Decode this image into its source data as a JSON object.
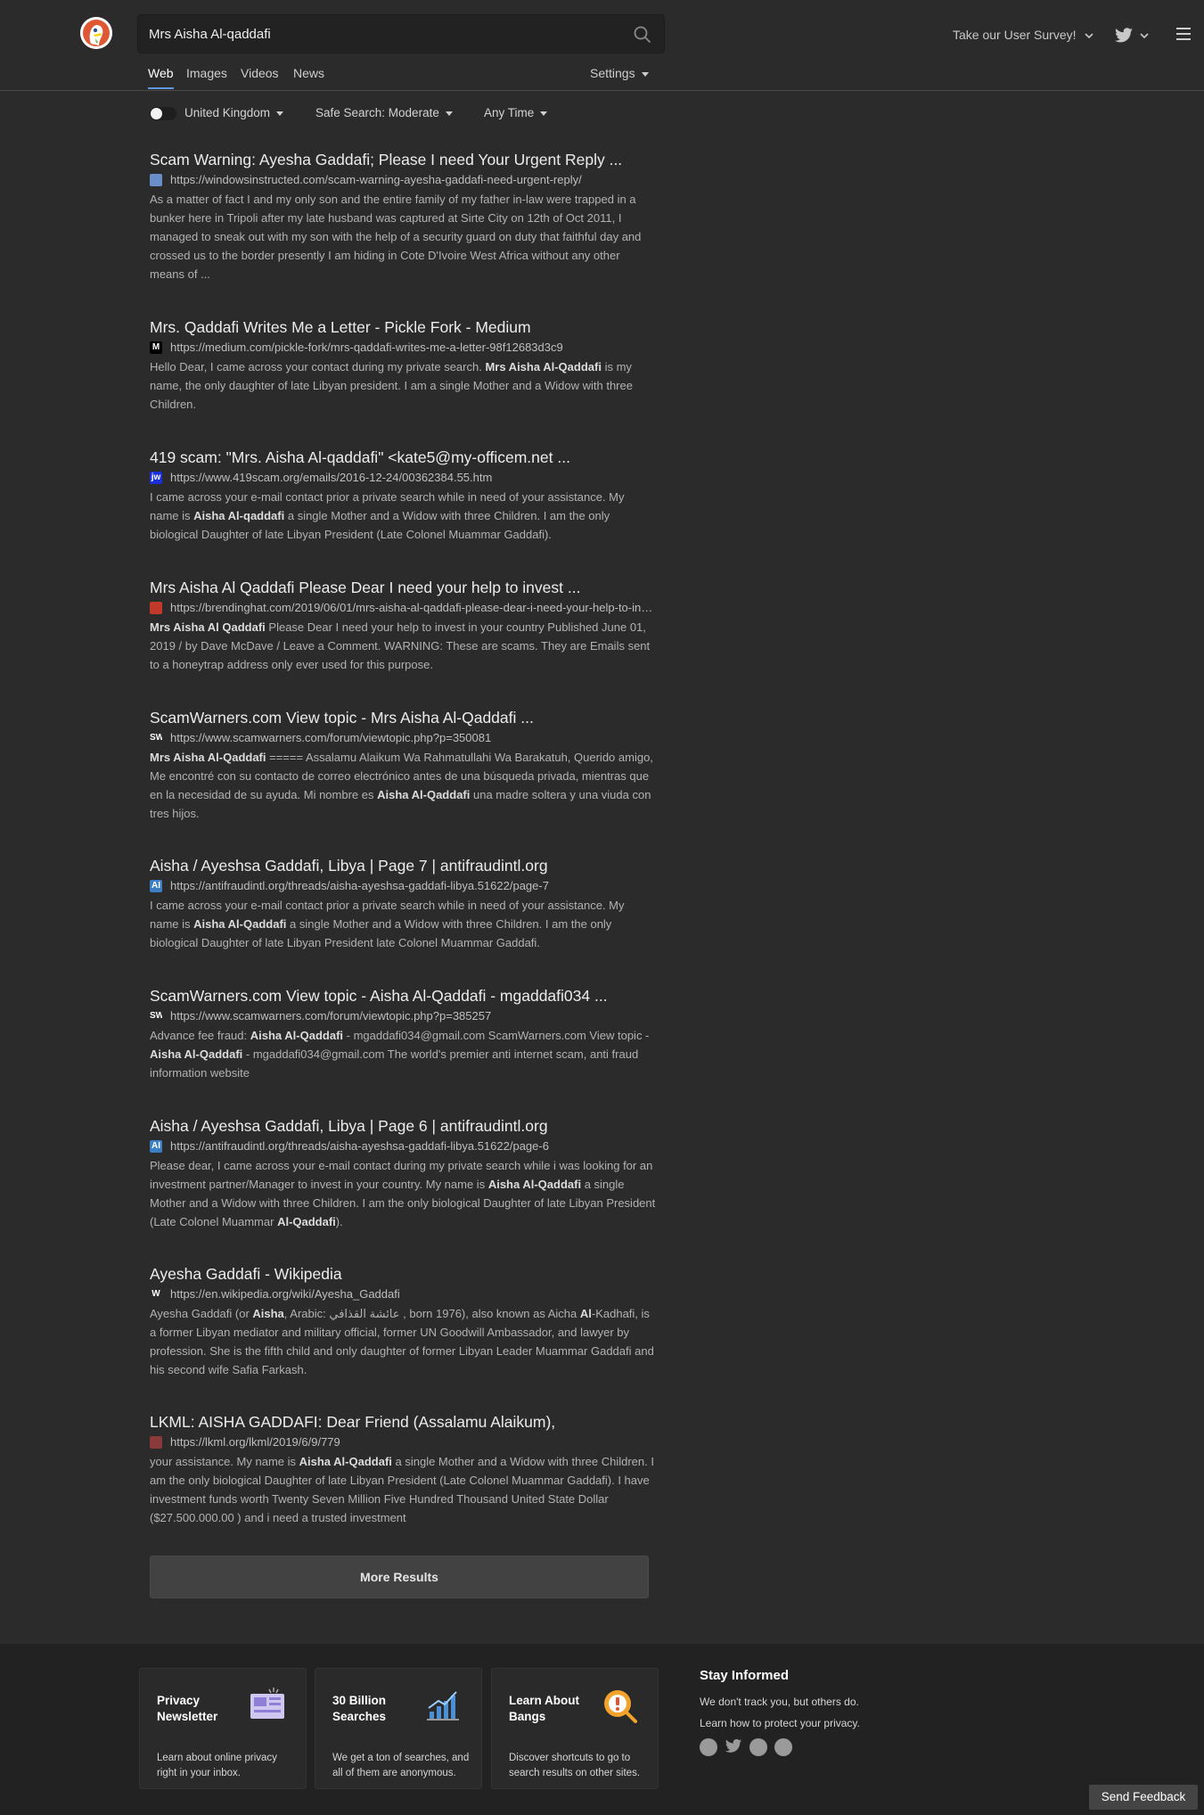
{
  "search": {
    "query": "Mrs Aisha Al-qaddafi"
  },
  "header": {
    "survey_label": "Take our User Survey!",
    "tabs": [
      {
        "label": "Web",
        "active": true
      },
      {
        "label": "Images",
        "active": false
      },
      {
        "label": "Videos",
        "active": false
      },
      {
        "label": "News",
        "active": false
      }
    ],
    "settings_label": "Settings"
  },
  "filters": {
    "region": "United Kingdom",
    "safe_search": "Safe Search: Moderate",
    "time": "Any Time"
  },
  "results": [
    {
      "title": "Scam Warning: Ayesha Gaddafi; Please I need Your Urgent Reply ...",
      "url": "https://windowsinstructed.com/scam-warning-ayesha-gaddafi-need-urgent-reply/",
      "favicon_color": "#6a8fc8",
      "snippet": [
        {
          "t": "As a matter of fact I and my only son and the entire family of my father in-law were trapped in a bunker here in Tripoli after my late husband was captured at Sirte City on 12th of Oct 2011, I managed to sneak out with my son with the help of a security guard on duty that faithful day and crossed us to the border presently I am hiding in Cote D'Ivoire West Africa without any other means of ...",
          "b": false
        }
      ]
    },
    {
      "title": "Mrs. Qaddafi Writes Me a Letter - Pickle Fork - Medium",
      "url": "https://medium.com/pickle-fork/mrs-qaddafi-writes-me-a-letter-98f12683d3c9",
      "favicon_color": "#000000",
      "favicon_text": "M",
      "snippet": [
        {
          "t": "Hello Dear, I came across your contact during my private search. ",
          "b": false
        },
        {
          "t": "Mrs Aisha Al-Qaddafi",
          "b": true
        },
        {
          "t": " is my name, the only daughter of late Libyan president. I am a single Mother and a Widow with three Children.",
          "b": false
        }
      ]
    },
    {
      "title": "419 scam: \"Mrs. Aisha Al-qaddafi\" <kate5@my-officem.net ...",
      "url": "https://www.419scam.org/emails/2016-12-24/00362384.55.htm",
      "favicon_color": "#1a2fd6",
      "favicon_text": "jw",
      "snippet": [
        {
          "t": "I came across your e-mail contact prior a private search while in need of your assistance. My name is ",
          "b": false
        },
        {
          "t": "Aisha Al-qaddafi",
          "b": true
        },
        {
          "t": " a single Mother and a Widow with three Children. I am the only biological Daughter of late Libyan President (Late Colonel Muammar Gaddafi).",
          "b": false
        }
      ]
    },
    {
      "title": "Mrs Aisha Al Qaddafi Please Dear I need your help to invest ...",
      "url": "https://brendinghat.com/2019/06/01/mrs-aisha-al-qaddafi-please-dear-i-need-your-help-to-invest/",
      "favicon_color": "#c0392b",
      "snippet": [
        {
          "t": "Mrs Aisha Al Qaddafi",
          "b": true
        },
        {
          "t": " Please Dear I need your help to invest in your country Published June 01, 2019 / by Dave McDave / Leave a Comment. WARNING: These are scams. They are Emails sent to a honeytrap address only ever used for this purpose.",
          "b": false
        }
      ]
    },
    {
      "title": "ScamWarners.com View topic - Mrs Aisha Al-Qaddafi ...",
      "url": "https://www.scamwarners.com/forum/viewtopic.php?p=350081",
      "favicon_color": "#2b2b2b",
      "favicon_text": "SW",
      "snippet": [
        {
          "t": "Mrs Aisha Al-Qaddafi",
          "b": true
        },
        {
          "t": " ===== Assalamu Alaikum Wa Rahmatullahi Wa Barakatuh, Querido amigo, Me encontré con su contacto de correo electrónico antes de una búsqueda privada, mientras que en la necesidad de su ayuda. Mi nombre es ",
          "b": false
        },
        {
          "t": "Aisha Al-Qaddafi",
          "b": true
        },
        {
          "t": " una madre soltera y una viuda con tres hijos.",
          "b": false
        }
      ]
    },
    {
      "title": "Aisha / Ayeshsa Gaddafi, Libya | Page 7 | antifraudintl.org",
      "url": "https://antifraudintl.org/threads/aisha-ayeshsa-gaddafi-libya.51622/page-7",
      "favicon_color": "#3d7fc4",
      "favicon_text": "AI",
      "snippet": [
        {
          "t": "I came across your e-mail contact prior a private search while in need of your assistance. My name is ",
          "b": false
        },
        {
          "t": "Aisha Al-Qaddafi",
          "b": true
        },
        {
          "t": " a single Mother and a Widow with three Children. I am the only biological Daughter of late Libyan President late Colonel Muammar Gaddafi.",
          "b": false
        }
      ]
    },
    {
      "title": "ScamWarners.com View topic - Aisha Al-Qaddafi - mgaddafi034 ...",
      "url": "https://www.scamwarners.com/forum/viewtopic.php?p=385257",
      "favicon_color": "#2b2b2b",
      "favicon_text": "SW",
      "snippet": [
        {
          "t": "Advance fee fraud: ",
          "b": false
        },
        {
          "t": "Aisha Al-Qaddafi",
          "b": true
        },
        {
          "t": " - mgaddafi034@gmail.com ScamWarners.com View topic - ",
          "b": false
        },
        {
          "t": "Aisha Al-Qaddafi",
          "b": true
        },
        {
          "t": " - mgaddafi034@gmail.com The world's premier anti internet scam, anti fraud information website",
          "b": false
        }
      ]
    },
    {
      "title": "Aisha / Ayeshsa Gaddafi, Libya | Page 6 | antifraudintl.org",
      "url": "https://antifraudintl.org/threads/aisha-ayeshsa-gaddafi-libya.51622/page-6",
      "favicon_color": "#3d7fc4",
      "favicon_text": "AI",
      "snippet": [
        {
          "t": "Please dear, I came across your e-mail contact during my private search while i was looking for an investment partner/Manager to invest in your country. My name is ",
          "b": false
        },
        {
          "t": "Aisha Al-Qaddafi",
          "b": true
        },
        {
          "t": " a single Mother and a Widow with three Children. I am the only biological Daughter of late Libyan President (Late Colonel Muammar ",
          "b": false
        },
        {
          "t": "Al-Qaddafi",
          "b": true
        },
        {
          "t": ").",
          "b": false
        }
      ]
    },
    {
      "title": "Ayesha Gaddafi - Wikipedia",
      "url": "https://en.wikipedia.org/wiki/Ayesha_Gaddafi",
      "favicon_color": "#2b2b2b",
      "favicon_text": "W",
      "snippet": [
        {
          "t": "Ayesha Gaddafi (or ",
          "b": false
        },
        {
          "t": "Aisha",
          "b": true
        },
        {
          "t": ", Arabic: عائشة القذافي , born 1976), also known as Aicha ",
          "b": false
        },
        {
          "t": "Al",
          "b": true
        },
        {
          "t": "-Kadhafi, is a former Libyan mediator and military official, former UN Goodwill Ambassador, and lawyer by profession. She is the fifth child and only daughter of former Libyan Leader Muammar Gaddafi and his second wife Safia Farkash.",
          "b": false
        }
      ]
    },
    {
      "title": "LKML: AISHA GADDAFI: Dear Friend (Assalamu Alaikum),",
      "url": "https://lkml.org/lkml/2019/6/9/779",
      "favicon_color": "#8a3a3a",
      "snippet": [
        {
          "t": "your assistance. My name is ",
          "b": false
        },
        {
          "t": "Aisha Al-Qaddafi",
          "b": true
        },
        {
          "t": " a single Mother and a Widow with three Children. I am the only biological Daughter of late Libyan President (Late Colonel Muammar Gaddafi). I have investment funds worth Twenty Seven Million Five Hundred Thousand United State Dollar ($27.500.000.00 ) and i need a trusted investment",
          "b": false
        }
      ]
    }
  ],
  "more_results_label": "More Results",
  "footer": {
    "cards": [
      {
        "title": "Privacy Newsletter",
        "text": "Learn about online privacy right in your inbox.",
        "icon": "newsletter-icon"
      },
      {
        "title": "30 Billion Searches",
        "text": "We get a ton of searches, and all of them are anonymous.",
        "icon": "chart-icon"
      },
      {
        "title": "Learn About Bangs",
        "text": "Discover shortcuts to go to search results on other sites.",
        "icon": "bang-icon"
      }
    ],
    "stay_title": "Stay Informed",
    "stay_line1": "We don't track you, but others do.",
    "stay_line2": "Learn how to protect your privacy."
  },
  "feedback_label": "Send Feedback"
}
